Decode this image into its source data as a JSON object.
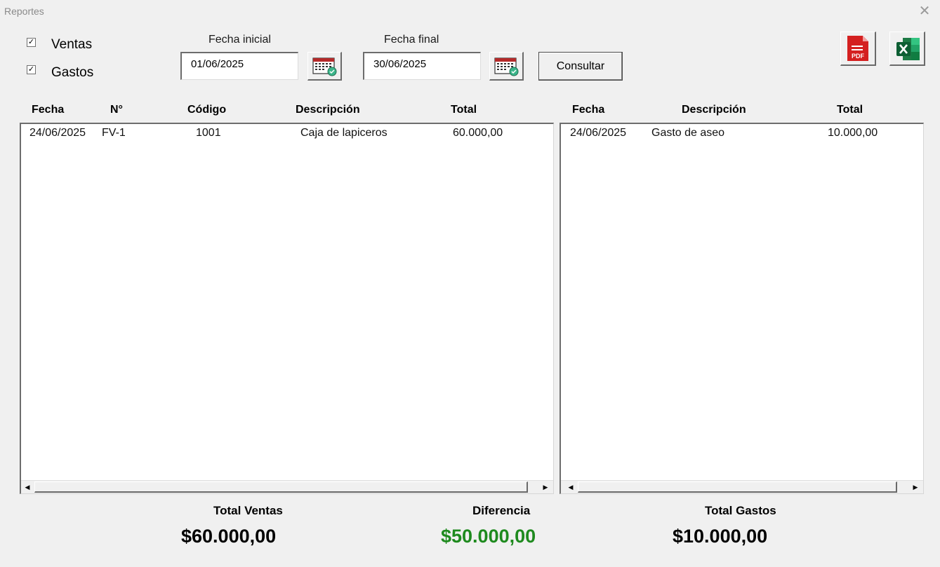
{
  "window": {
    "title": "Reportes",
    "close_glyph": "✕"
  },
  "filters": {
    "ventas": {
      "label": "Ventas",
      "checked": true,
      "mark": "✓"
    },
    "gastos": {
      "label": "Gastos",
      "checked": true,
      "mark": "✓"
    }
  },
  "dates": {
    "start": {
      "label": "Fecha inicial",
      "value": "01/06/2025"
    },
    "end": {
      "label": "Fecha final",
      "value": "30/06/2025"
    }
  },
  "actions": {
    "consult_label": "Consultar",
    "pdf_label": "PDF"
  },
  "ventas_table": {
    "headers": [
      "Fecha",
      "N°",
      "Código",
      "Descripción",
      "Total"
    ],
    "rows": [
      [
        "24/06/2025",
        "FV-1",
        "1001",
        "Caja de lapiceros",
        "60.000,00"
      ]
    ]
  },
  "gastos_table": {
    "headers": [
      "Fecha",
      "Descripción",
      "Total"
    ],
    "rows": [
      [
        "24/06/2025",
        "Gasto de aseo",
        "10.000,00"
      ]
    ]
  },
  "summary": {
    "total_ventas_label": "Total Ventas",
    "total_ventas_value": "$60.000,00",
    "diferencia_label": "Diferencia",
    "diferencia_value": "$50.000,00",
    "total_gastos_label": "Total Gastos",
    "total_gastos_value": "$10.000,00"
  },
  "colors": {
    "diferencia": "#1e8a1e",
    "pdf_red": "#d42020",
    "excel_green": "#1d7a45"
  }
}
